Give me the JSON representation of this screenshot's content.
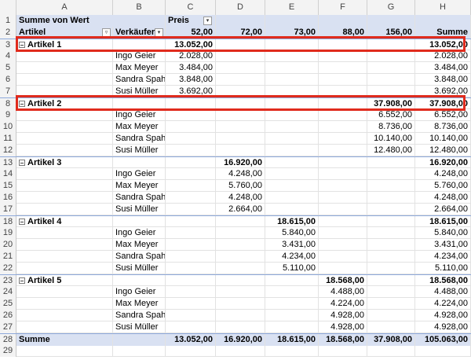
{
  "columns": [
    "A",
    "B",
    "C",
    "D",
    "E",
    "F",
    "G",
    "H"
  ],
  "pivot": {
    "title": "Summe von Wert",
    "col_field": "Preis",
    "row_field": "Artikel",
    "sub_field": "Verkäufer",
    "price_headers": [
      "52,00",
      "72,00",
      "73,00",
      "88,00",
      "156,00"
    ],
    "sum_header": "Summe",
    "groups": [
      {
        "label": "Artikel 1",
        "price_col": 0,
        "total": "13.052,00",
        "rows": [
          {
            "seller": "Ingo Geier",
            "value": "2.028,00"
          },
          {
            "seller": "Max Meyer",
            "value": "3.484,00"
          },
          {
            "seller": "Sandra Spahn",
            "value": "3.848,00"
          },
          {
            "seller": "Susi Müller",
            "value": "3.692,00"
          }
        ]
      },
      {
        "label": "Artikel 2",
        "price_col": 4,
        "total": "37.908,00",
        "rows": [
          {
            "seller": "Ingo Geier",
            "value": "6.552,00"
          },
          {
            "seller": "Max Meyer",
            "value": "8.736,00"
          },
          {
            "seller": "Sandra Spahn",
            "value": "10.140,00"
          },
          {
            "seller": "Susi Müller",
            "value": "12.480,00"
          }
        ]
      },
      {
        "label": "Artikel 3",
        "price_col": 1,
        "total": "16.920,00",
        "rows": [
          {
            "seller": "Ingo Geier",
            "value": "4.248,00"
          },
          {
            "seller": "Max Meyer",
            "value": "5.760,00"
          },
          {
            "seller": "Sandra Spahn",
            "value": "4.248,00"
          },
          {
            "seller": "Susi Müller",
            "value": "2.664,00"
          }
        ]
      },
      {
        "label": "Artikel 4",
        "price_col": 2,
        "total": "18.615,00",
        "rows": [
          {
            "seller": "Ingo Geier",
            "value": "5.840,00"
          },
          {
            "seller": "Max Meyer",
            "value": "3.431,00"
          },
          {
            "seller": "Sandra Spahn",
            "value": "4.234,00"
          },
          {
            "seller": "Susi Müller",
            "value": "5.110,00"
          }
        ]
      },
      {
        "label": "Artikel 5",
        "price_col": 3,
        "total": "18.568,00",
        "rows": [
          {
            "seller": "Ingo Geier",
            "value": "4.488,00"
          },
          {
            "seller": "Max Meyer",
            "value": "4.224,00"
          },
          {
            "seller": "Sandra Spahn",
            "value": "4.928,00"
          },
          {
            "seller": "Susi Müller",
            "value": "4.928,00"
          }
        ]
      }
    ],
    "grand_label": "Summe",
    "grand_totals": [
      "13.052,00",
      "16.920,00",
      "18.615,00",
      "18.568,00",
      "37.908,00",
      "105.063,00"
    ],
    "extra_row": "29"
  },
  "highlighted_groups": [
    "Artikel 1",
    "Artikel 2"
  ],
  "colors": {
    "header_fill": "#d9e1f2",
    "highlight": "#e02b1d",
    "header_line": "#8ea9db"
  }
}
